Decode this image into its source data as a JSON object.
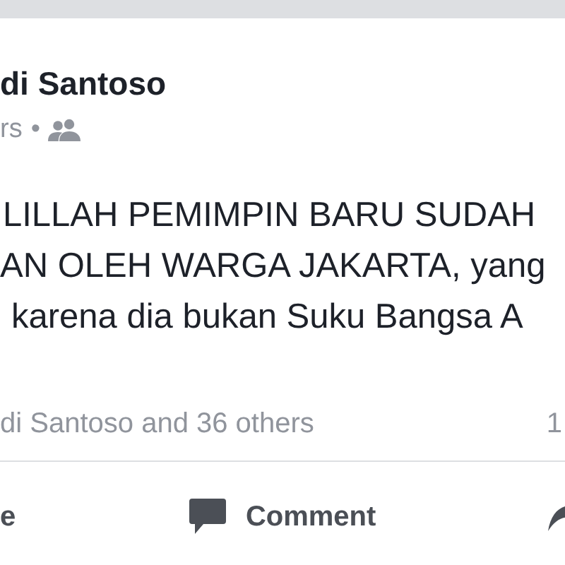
{
  "post": {
    "author": "di Santoso",
    "meta": "rs",
    "separator": "•",
    "body": [
      "LILLAH PEMIMPIN BARU SUDAH",
      "AN OLEH WARGA JAKARTA, yang",
      "karena dia bukan Suku Bangsa A"
    ],
    "reactions": "di Santoso and 36 others",
    "comments_count": "1"
  },
  "actions": [
    {
      "kind": "like",
      "label": "e"
    },
    {
      "kind": "comment",
      "label": "Comment"
    },
    {
      "kind": "share"
    }
  ]
}
